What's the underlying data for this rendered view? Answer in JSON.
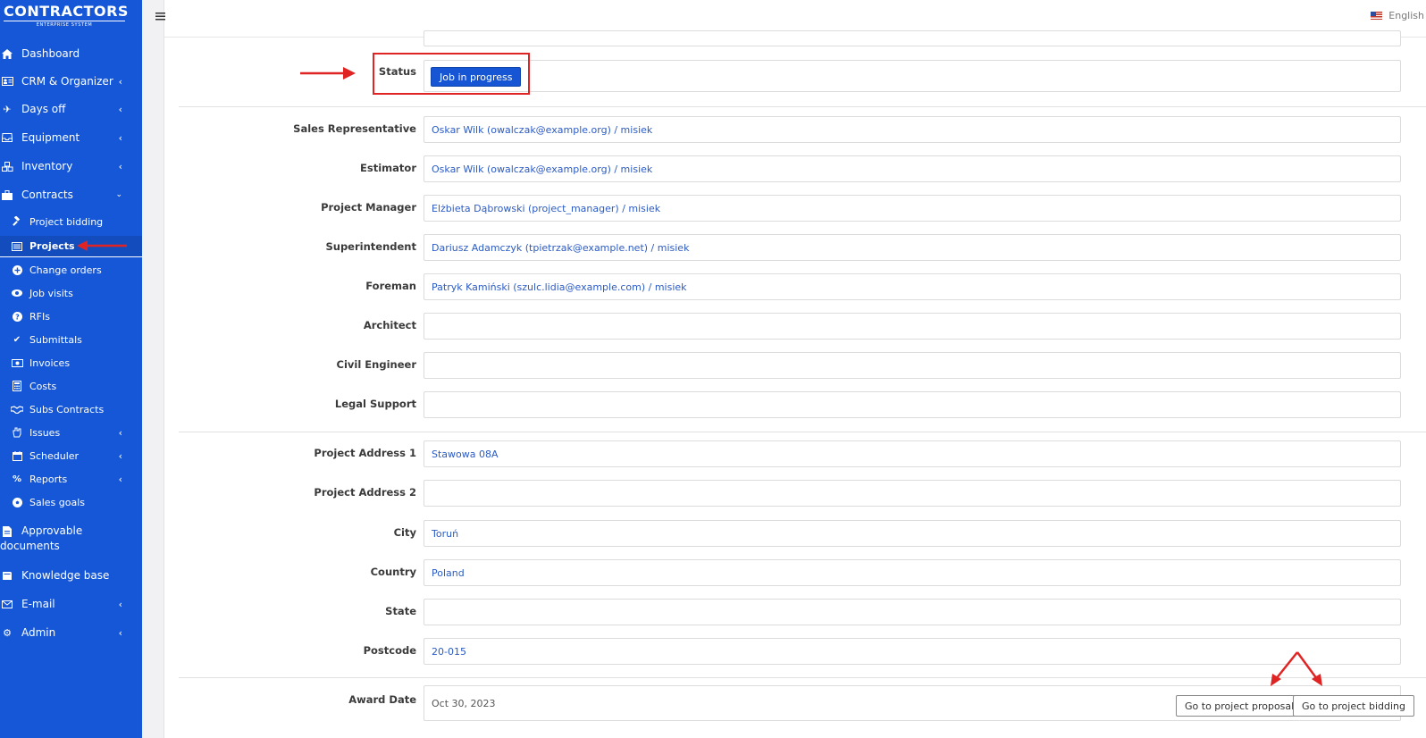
{
  "brand": {
    "logo_line1": "CONTRACTORS",
    "logo_line2": "ENTERPRISE SYSTEM"
  },
  "topbar": {
    "menu_icon": "hamburger-icon",
    "language": "English"
  },
  "sidebar": {
    "items": [
      {
        "label": "Dashboard",
        "icon": "home-icon"
      },
      {
        "label": "CRM & Organizer",
        "icon": "id-card-icon"
      },
      {
        "label": "Days off",
        "icon": "plane-icon"
      },
      {
        "label": "Equipment",
        "icon": "inbox-icon"
      },
      {
        "label": "Inventory",
        "icon": "cubes-icon"
      },
      {
        "label": "Contracts",
        "icon": "briefcase-icon"
      },
      {
        "label": "Approvable",
        "label2": "documents",
        "icon": "file-icon"
      },
      {
        "label": "Knowledge base",
        "icon": "book-icon"
      },
      {
        "label": "E-mail",
        "icon": "envelope-icon"
      },
      {
        "label": "Admin",
        "icon": "cogs-icon"
      }
    ],
    "subitems": [
      {
        "label": "Project bidding",
        "icon": "gavel-icon"
      },
      {
        "label": "Projects",
        "icon": "list-icon"
      },
      {
        "label": "Change orders",
        "icon": "plus-circle-icon"
      },
      {
        "label": "Job visits",
        "icon": "eye-icon"
      },
      {
        "label": "RFIs",
        "icon": "question-icon"
      },
      {
        "label": "Submittals",
        "icon": "check-icon"
      },
      {
        "label": "Invoices",
        "icon": "money-icon"
      },
      {
        "label": "Costs",
        "icon": "calculator-icon"
      },
      {
        "label": "Subs Contracts",
        "icon": "handshake-icon"
      },
      {
        "label": "Issues",
        "icon": "hand-icon"
      },
      {
        "label": "Scheduler",
        "icon": "calendar-icon"
      },
      {
        "label": "Reports",
        "icon": "percent-icon"
      },
      {
        "label": "Sales goals",
        "icon": "futbol-icon"
      }
    ]
  },
  "form": {
    "status": {
      "label": "Status",
      "value": "Job in progress"
    },
    "people": [
      {
        "label": "Sales Representative",
        "value": "Oskar Wilk (owalczak@example.org) / misiek"
      },
      {
        "label": "Estimator",
        "value": "Oskar Wilk (owalczak@example.org) / misiek"
      },
      {
        "label": "Project Manager",
        "value": "Elżbieta Dąbrowski (project_manager) / misiek"
      },
      {
        "label": "Superintendent",
        "value": "Dariusz Adamczyk (tpietrzak@example.net) / misiek"
      },
      {
        "label": "Foreman",
        "value": "Patryk Kamiński (szulc.lidia@example.com) / misiek"
      },
      {
        "label": "Architect",
        "value": ""
      },
      {
        "label": "Civil Engineer",
        "value": ""
      },
      {
        "label": "Legal Support",
        "value": ""
      }
    ],
    "address": [
      {
        "label": "Project Address 1",
        "value": "Stawowa 08A"
      },
      {
        "label": "Project Address 2",
        "value": ""
      },
      {
        "label": "City",
        "value": "Toruń"
      },
      {
        "label": "Country",
        "value": "Poland"
      },
      {
        "label": "State",
        "value": ""
      },
      {
        "label": "Postcode",
        "value": "20-015"
      }
    ],
    "award": {
      "label": "Award Date",
      "value": "Oct 30, 2023"
    },
    "buttons": {
      "proposal": "Go to project proposal",
      "bidding": "Go to project bidding"
    }
  },
  "colors": {
    "sidebar": "#1557d6",
    "accent": "#1656d4",
    "annotation": "#e02424"
  }
}
